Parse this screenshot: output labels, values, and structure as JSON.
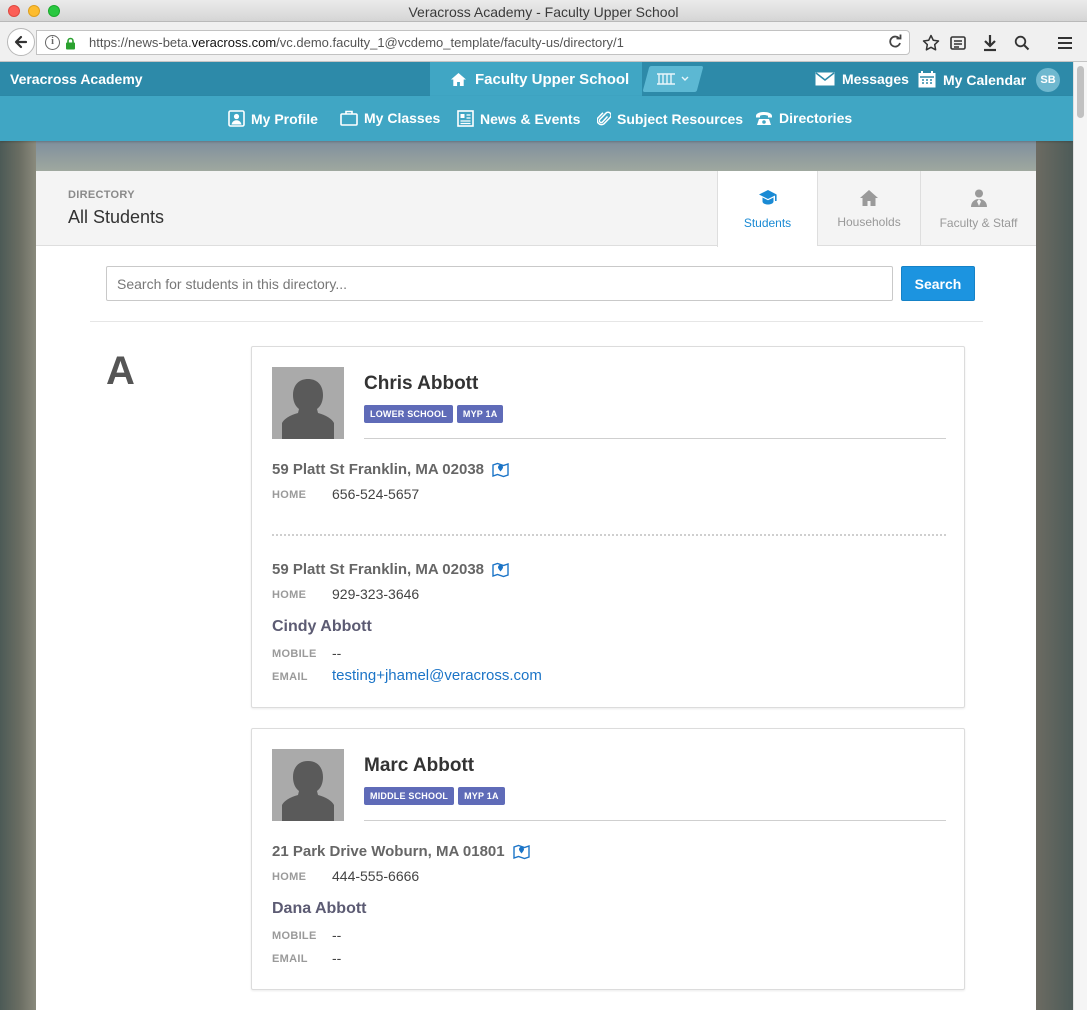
{
  "browser": {
    "window_title": "Veracross Academy - Faculty Upper School",
    "url_prefix": "https://news-beta.",
    "url_domain": "veracross.com",
    "url_rest": "/vc.demo.faculty_1@vcdemo_template/faculty-us/directory/1"
  },
  "header": {
    "school_name": "Veracross Academy",
    "portal_name": "Faculty Upper School",
    "messages_label": "Messages",
    "calendar_label": "My Calendar",
    "user_initials": "SB"
  },
  "nav": {
    "items": [
      {
        "label": "My Profile",
        "icon": "profile-icon"
      },
      {
        "label": "My Classes",
        "icon": "briefcase-icon"
      },
      {
        "label": "News & Events",
        "icon": "news-icon"
      },
      {
        "label": "Subject Resources",
        "icon": "paperclip-icon"
      },
      {
        "label": "Directories",
        "icon": "phone-icon"
      }
    ]
  },
  "directory": {
    "eyebrow": "DIRECTORY",
    "title": "All Students",
    "tabs": [
      {
        "label": "Students",
        "icon": "graduation-cap-icon",
        "active": true
      },
      {
        "label": "Households",
        "icon": "house-icon",
        "active": false
      },
      {
        "label": "Faculty & Staff",
        "icon": "person-icon",
        "active": false
      }
    ],
    "search_placeholder": "Search for students in this directory...",
    "search_button": "Search",
    "section_letter": "A"
  },
  "students": [
    {
      "name": "Chris Abbott",
      "badges": [
        "LOWER SCHOOL",
        "MYP 1A"
      ],
      "address_1": "59 Platt St Franklin, MA 02038",
      "home_label_1": "HOME",
      "home_phone_1": "656-524-5657",
      "address_2": "59 Platt St Franklin, MA 02038",
      "home_label_2": "HOME",
      "home_phone_2": "929-323-3646",
      "parent_name": "Cindy Abbott",
      "mobile_label": "MOBILE",
      "mobile": "--",
      "email_label": "EMAIL",
      "email": "testing+jhamel@veracross.com"
    },
    {
      "name": "Marc Abbott",
      "badges": [
        "MIDDLE SCHOOL",
        "MYP 1A"
      ],
      "address_1": "21 Park Drive Woburn, MA 01801",
      "home_label_1": "HOME",
      "home_phone_1": "444-555-6666",
      "parent_name": "Dana Abbott",
      "mobile_label": "MOBILE",
      "mobile": "--",
      "email_label": "EMAIL",
      "email": "--"
    }
  ],
  "colors": {
    "header_dark": "#2d8aa9",
    "header_light": "#40a6c4",
    "accent": "#1c94e0",
    "badge": "#5f6bb8"
  }
}
